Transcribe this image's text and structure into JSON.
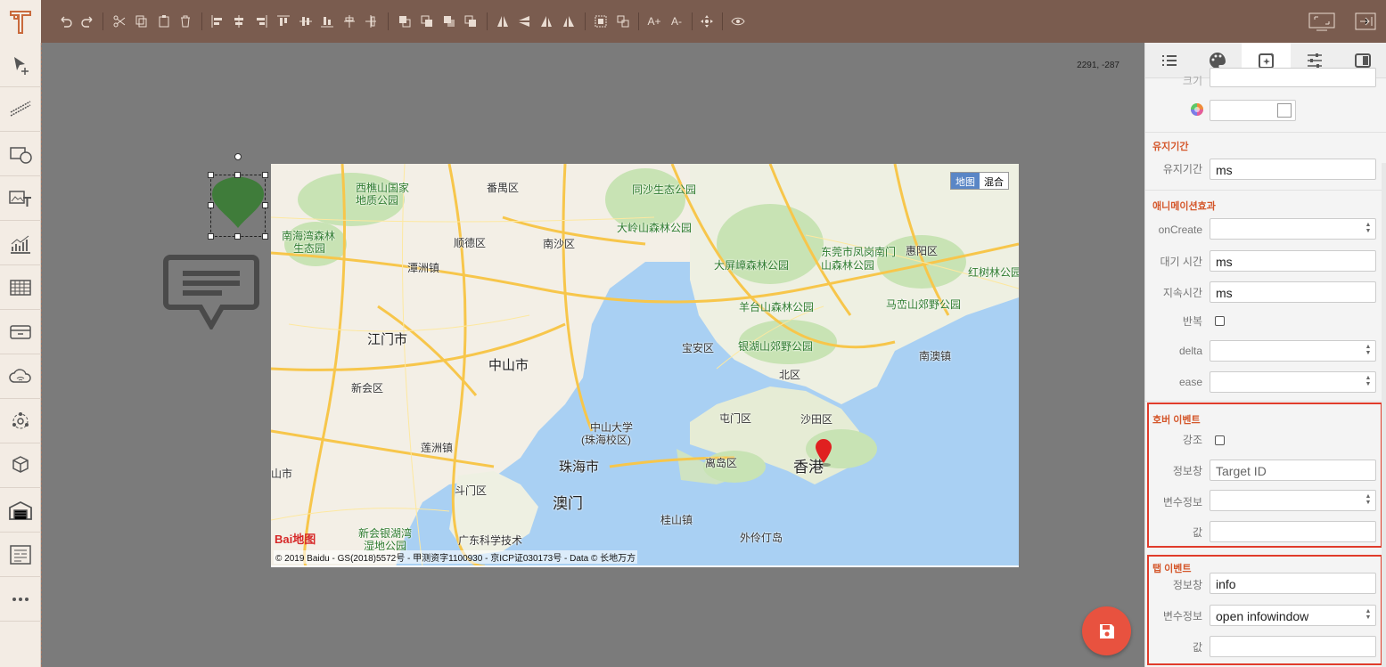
{
  "toolbar": {
    "icons": [
      "undo-icon",
      "redo-icon",
      "cut-icon",
      "copy-icon",
      "paste-icon",
      "delete-icon",
      "align-left-icon",
      "align-center-icon",
      "align-right-icon",
      "align-top-icon",
      "align-middle-icon",
      "align-bottom-icon",
      "distribute-h-icon",
      "distribute-v-icon",
      "bring-front-icon",
      "bring-forward-icon",
      "send-backward-icon",
      "send-back-icon",
      "flip-h-icon",
      "flip-v-icon",
      "rotate-left-icon",
      "rotate-right-icon",
      "group-icon",
      "ungroup-icon",
      "font-increase-icon",
      "font-decrease-icon",
      "move-icon",
      "preview-icon",
      "fullscreen-icon",
      "exit-icon"
    ],
    "font_up": "A+",
    "font_down": "A-"
  },
  "canvas": {
    "coords": "2291, -287"
  },
  "map": {
    "type_map": "地图",
    "type_hybrid": "混合",
    "copyright": "© 2019 Baidu - GS(2018)5572号 - 甲测资字1100930 - 京ICP证030173号 - Data © 长地万方",
    "logo_text": "Bai地图",
    "labels": {
      "l1": "西樵山国家",
      "l1b": "地质公园",
      "l2": "番禺区",
      "l3": "同沙生态公园",
      "l4": "大岭山森林公园",
      "l5": "南海湾森林",
      "l5b": "生态园",
      "l6": "顺德区",
      "l7": "南沙区",
      "l8": "东莞市凤岗南门",
      "l8b": "山森林公园",
      "l9": "惠阳区",
      "l10": "大屏嶂森林公园",
      "l11": "红树林公园",
      "l12": "潭洲镇",
      "l13": "羊台山森林公园",
      "l14": "马峦山郊野公园",
      "l15": "江门市",
      "l16": "宝安区",
      "l17": "银湖山郊野公园",
      "l18": "中山市",
      "l19": "南澳镇",
      "l20": "新会区",
      "l21": "北区",
      "l22": "屯门区",
      "l23": "沙田区",
      "l24": "中山大学",
      "l24b": "(珠海校区)",
      "l25": "莲洲镇",
      "l26": "珠海市",
      "l27": "离岛区",
      "l28": "香港",
      "l29": "斗门区",
      "l30": "澳门",
      "l31": "山市",
      "l32": "桂山镇",
      "l33": "新会银湖湾",
      "l33b": "湿地公园",
      "l34": "广东科学技术",
      "l35": "外伶仃岛"
    }
  },
  "panel": {
    "tabs": [
      "list-icon",
      "palette-icon",
      "effect-icon",
      "sliders-icon",
      "layer-icon"
    ],
    "cut_label": "크기",
    "sections": {
      "duration_title": "유지기간",
      "duration_label": "유지기간",
      "duration_value": "ms",
      "anim_title": "애니메이션효과",
      "oncreate_label": "onCreate",
      "wait_label": "대기 시간",
      "wait_value": "ms",
      "keep_label": "지속시간",
      "keep_value": "ms",
      "repeat_label": "반복",
      "delta_label": "delta",
      "ease_label": "ease",
      "hover_title": "호버 이벤트",
      "emphasis_label": "강조",
      "hover_info_label": "정보창",
      "hover_info_value": "Target ID",
      "hover_var_label": "변수정보",
      "hover_val_label": "값",
      "tap_title": "탭 이벤트",
      "tap_info_label": "정보창",
      "tap_info_value": "info",
      "tap_var_label": "변수정보",
      "tap_var_value": "open infowindow",
      "tap_val_label": "값"
    }
  },
  "colors": {
    "topbar": "#7a5c4f",
    "accent": "#d4562a",
    "highlight": "#e03c2b",
    "save": "#e8523f",
    "shape": "#3f7c3a"
  }
}
